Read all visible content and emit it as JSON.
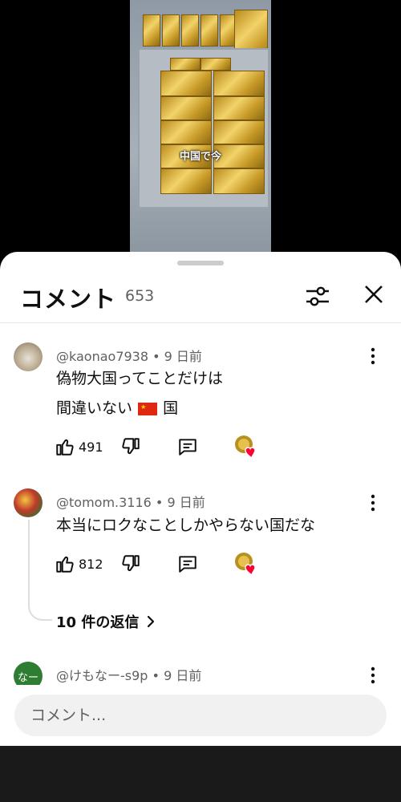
{
  "video": {
    "caption": "中国で今"
  },
  "header": {
    "title": "コメント",
    "count": "653"
  },
  "comments": [
    {
      "author": "@kaonao7938",
      "time": "9 日前",
      "line1": "偽物大国ってことだけは",
      "line2_pre": "間違いない",
      "flag": "🇨🇳",
      "line2_post": "国",
      "likes": "491"
    },
    {
      "author": "@tomom.3116",
      "time": "9 日前",
      "line1": "本当にロクなことしかやらない国だな",
      "likes": "812",
      "replies": "10 件の返信"
    },
    {
      "author": "@けもなー-s9p",
      "time": "9 日前",
      "avatar_text": "なー"
    }
  ],
  "input": {
    "placeholder": "コメント..."
  },
  "colors": {
    "heart": "#ff0033",
    "avatar3": "#2e7d32",
    "divider": "#e5e5e5"
  }
}
